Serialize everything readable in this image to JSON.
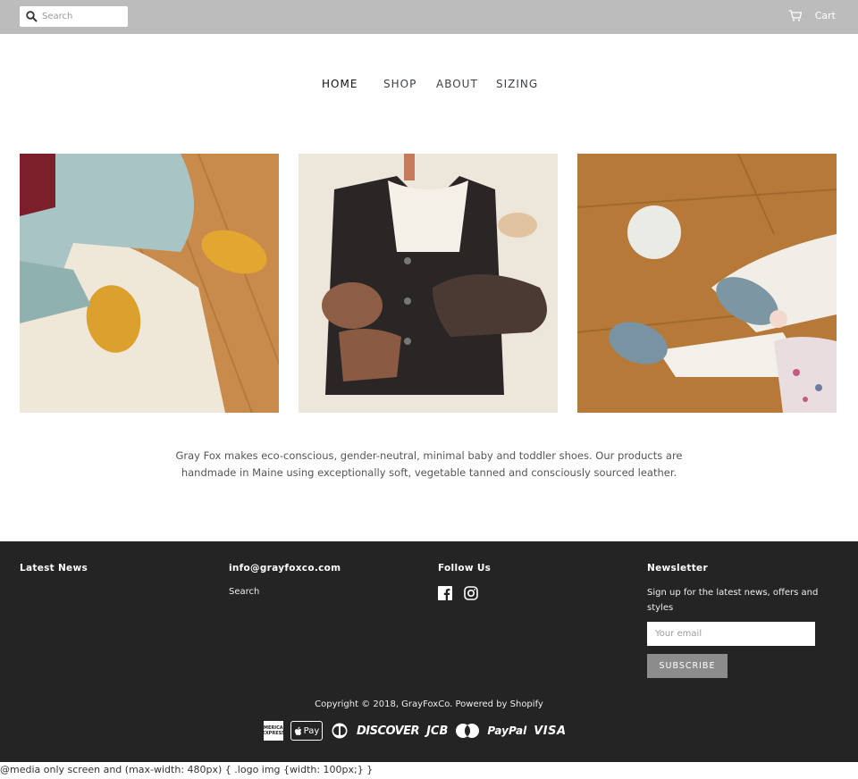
{
  "topbar": {
    "search_placeholder": "Search",
    "cart_label": "Cart"
  },
  "nav": {
    "items": [
      "HOME",
      "SHOP",
      "ABOUT",
      "SIZING"
    ]
  },
  "gallery": {
    "images": [
      {
        "alt": "baby wearing mustard leather shoes on sheepskin"
      },
      {
        "alt": "wool vest with leather shoes and toy lamb"
      },
      {
        "alt": "baby in gray leather shoes with felt ball"
      }
    ]
  },
  "about": {
    "text": "Gray Fox makes eco-conscious, gender-neutral, minimal baby and toddler shoes. Our products are handmade in Maine using exceptionally soft, vegetable tanned and consciously sourced leather."
  },
  "footer": {
    "latest_news_title": "Latest News",
    "contact_title": "info@grayfoxco.com",
    "contact_link": "Search",
    "follow_title": "Follow Us",
    "newsletter_title": "Newsletter",
    "newsletter_text": "Sign up for the latest news, offers and styles",
    "email_placeholder": "Your email",
    "subscribe_label": "SUBSCRIBE",
    "copyright": "Copyright © 2018, GrayFoxCo. Powered by Shopify",
    "payments": {
      "amex": "AMERICAN EXPRESS",
      "apple": "Pay",
      "discover": "DISCOVER",
      "jcb": "JCB",
      "paypal": "PayPal",
      "visa": "VISA"
    }
  },
  "css_note": "@media only screen and (max-width: 480px) { .logo img {width: 100px;} }"
}
